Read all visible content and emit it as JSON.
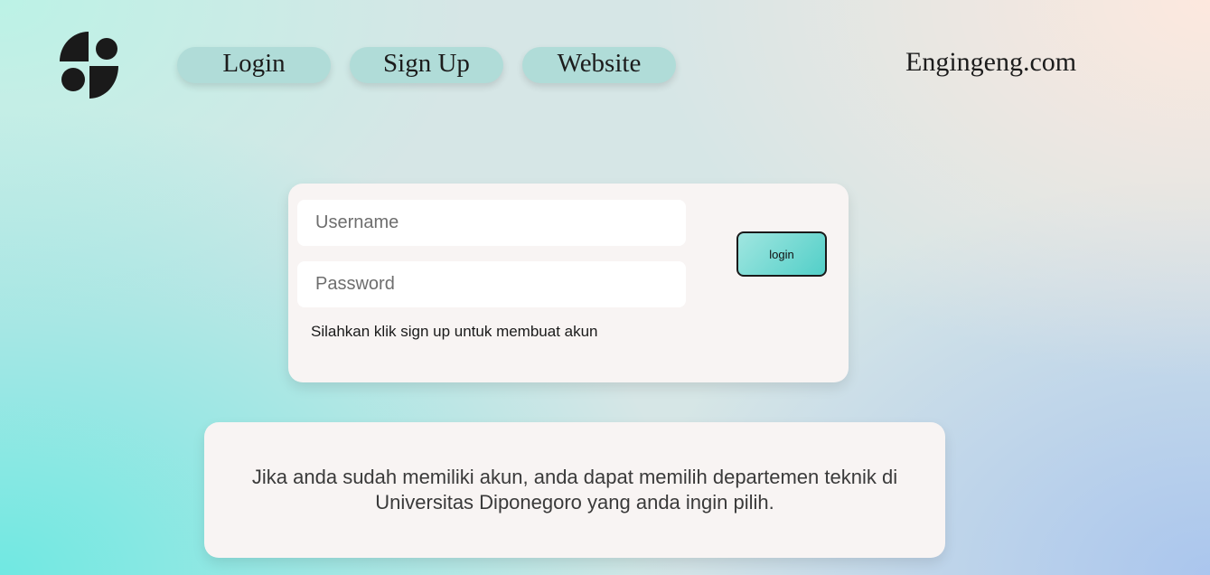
{
  "logo": {
    "icon": "abstract-circles-logo-icon"
  },
  "nav": {
    "login_label": "Login",
    "signup_label": "Sign Up",
    "website_label": "Website"
  },
  "site_name": "Engingeng.com",
  "login_form": {
    "username_placeholder": "Username",
    "username_value": "",
    "password_placeholder": "Password",
    "password_value": "",
    "hint": "Silahkan klik sign up untuk membuat akun",
    "login_button_label": "login"
  },
  "info": {
    "text": "Jika anda sudah memiliki akun, anda dapat memilih departemen teknik di Universitas Diponegoro yang anda ingin pilih."
  },
  "colors": {
    "nav_button_bg": "#b0dcd8",
    "card_bg": "#f8f4f3",
    "login_button_gradient_start": "#a0e6e0",
    "login_button_gradient_end": "#52cfc8"
  }
}
